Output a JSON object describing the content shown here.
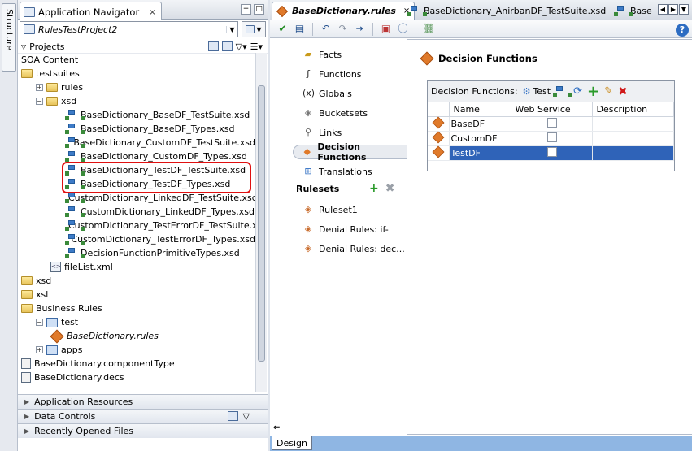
{
  "structure_tab": {
    "label": "Structure"
  },
  "navigator": {
    "tab_label": "Application Navigator",
    "close_glyph": "×",
    "project_name": "RulesTestProject2",
    "projects_label": "Projects"
  },
  "tree": [
    {
      "label": "SOA Content",
      "indent": 0,
      "icon": "none"
    },
    {
      "label": "testsuites",
      "indent": 0,
      "icon": "folder"
    },
    {
      "label": "rules",
      "indent": 1,
      "icon": "folder",
      "expander": "+"
    },
    {
      "label": "xsd",
      "indent": 1,
      "icon": "folder",
      "expander": "−"
    },
    {
      "label": "BaseDictionary_BaseDF_TestSuite.xsd",
      "indent": 3,
      "icon": "xsd"
    },
    {
      "label": "BaseDictionary_BaseDF_Types.xsd",
      "indent": 3,
      "icon": "xsd"
    },
    {
      "label": "BaseDictionary_CustomDF_TestSuite.xsd",
      "indent": 3,
      "icon": "xsd"
    },
    {
      "label": "BaseDictionary_CustomDF_Types.xsd",
      "indent": 3,
      "icon": "xsd"
    },
    {
      "label": "BaseDictionary_TestDF_TestSuite.xsd",
      "indent": 3,
      "icon": "xsd"
    },
    {
      "label": "BaseDictionary_TestDF_Types.xsd",
      "indent": 3,
      "icon": "xsd"
    },
    {
      "label": "CustomDictionary_LinkedDF_TestSuite.xsd",
      "indent": 3,
      "icon": "xsd"
    },
    {
      "label": "CustomDictionary_LinkedDF_Types.xsd",
      "indent": 3,
      "icon": "xsd"
    },
    {
      "label": "CustomDictionary_TestErrorDF_TestSuite.x",
      "indent": 3,
      "icon": "xsd"
    },
    {
      "label": "CustomDictionary_TestErrorDF_Types.xsd",
      "indent": 3,
      "icon": "xsd"
    },
    {
      "label": "DecisionFunctionPrimitiveTypes.xsd",
      "indent": 3,
      "icon": "xsd"
    },
    {
      "label": "fileList.xml",
      "indent": 2,
      "icon": "xml"
    },
    {
      "label": "xsd",
      "indent": 0,
      "icon": "folder"
    },
    {
      "label": "xsl",
      "indent": 0,
      "icon": "folder"
    },
    {
      "label": "Business Rules",
      "indent": 0,
      "icon": "folder"
    },
    {
      "label": "test",
      "indent": 1,
      "icon": "proj",
      "expander": "−"
    },
    {
      "label": "BaseDictionary.rules",
      "indent": 2,
      "icon": "rules",
      "italic": true
    },
    {
      "label": "apps",
      "indent": 1,
      "icon": "proj",
      "expander": "+"
    },
    {
      "label": "BaseDictionary.componentType",
      "indent": 0,
      "icon": "comp"
    },
    {
      "label": "BaseDictionary.decs",
      "indent": 0,
      "icon": "comp"
    }
  ],
  "accordions": {
    "app_resources": "Application Resources",
    "data_controls": "Data Controls",
    "recent_files": "Recently Opened Files"
  },
  "editor": {
    "tabs": [
      {
        "label": "BaseDictionary.rules"
      },
      {
        "label": "BaseDictionary_AnirbanDF_TestSuite.xsd"
      },
      {
        "label": "Base"
      }
    ],
    "close_glyph": "×"
  },
  "nav": {
    "items": [
      {
        "label": "Facts",
        "icon": "facts-icon"
      },
      {
        "label": "Functions",
        "icon": "functions-icon"
      },
      {
        "label": "Globals",
        "icon": "globals-icon"
      },
      {
        "label": "Bucketsets",
        "icon": "bucketsets-icon"
      },
      {
        "label": "Links",
        "icon": "links-icon"
      },
      {
        "label": "Decision Functions",
        "icon": "decision-functions-icon"
      },
      {
        "label": "Translations",
        "icon": "translations-icon"
      }
    ],
    "rulesets_label": "Rulesets",
    "rulesets": [
      {
        "label": "Ruleset1"
      },
      {
        "label": "Denial Rules: if-"
      },
      {
        "label": "Denial Rules: dec..."
      }
    ]
  },
  "decision_functions": {
    "title": "Decision Functions",
    "box_label": "Decision Functions:",
    "test_label": "Test",
    "columns": [
      "Name",
      "Web Service",
      "Description"
    ],
    "rows": [
      {
        "name": "BaseDF",
        "web_service": false,
        "description": ""
      },
      {
        "name": "CustomDF",
        "web_service": false,
        "description": ""
      },
      {
        "name": "TestDF",
        "web_service": false,
        "description": "",
        "selected": true
      }
    ]
  },
  "bottom": {
    "design_tab": "Design"
  },
  "colors": {
    "selection": "#2f63b8",
    "highlight_box": "#e01010",
    "design_bar": "#8fb6e3"
  }
}
